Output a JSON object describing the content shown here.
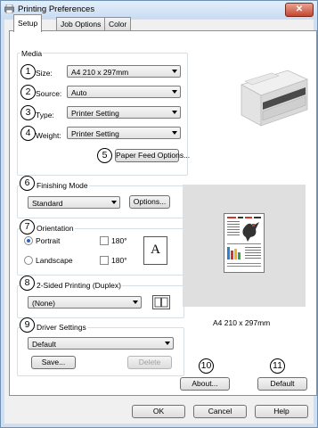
{
  "window": {
    "title": "Printing Preferences",
    "close_label": "✕"
  },
  "tabs": [
    {
      "label": "Setup"
    },
    {
      "label": "Job Options"
    },
    {
      "label": "Color"
    }
  ],
  "media": {
    "group_label": "Media",
    "size_label": "Size:",
    "size_value": "A4 210 x 297mm",
    "source_label": "Source:",
    "source_value": "Auto",
    "type_label": "Type:",
    "type_value": "Printer Setting",
    "weight_label": "Weight:",
    "weight_value": "Printer Setting",
    "paper_feed_button": "Paper Feed Options..."
  },
  "finishing": {
    "group_label": "Finishing Mode",
    "value": "Standard",
    "options_button": "Options..."
  },
  "orientation": {
    "group_label": "Orientation",
    "portrait_label": "Portrait",
    "landscape_label": "Landscape",
    "rotate_label_1": "180°",
    "rotate_label_2": "180°",
    "preview_letter": "A",
    "selected": "Portrait"
  },
  "duplex": {
    "group_label": "2-Sided Printing (Duplex)",
    "value": "(None)"
  },
  "driver_settings": {
    "group_label": "Driver Settings",
    "value": "Default",
    "save_button": "Save...",
    "delete_button": "Delete"
  },
  "preview": {
    "paper_size_text": "A4 210 x 297mm"
  },
  "callouts": {
    "n1": "1",
    "n2": "2",
    "n3": "3",
    "n4": "4",
    "n5": "5",
    "n6": "6",
    "n7": "7",
    "n8": "8",
    "n9": "9",
    "n10": "10",
    "n11": "11"
  },
  "side_buttons": {
    "about": "About...",
    "default": "Default"
  },
  "footer": {
    "ok": "OK",
    "cancel": "Cancel",
    "help": "Help"
  }
}
